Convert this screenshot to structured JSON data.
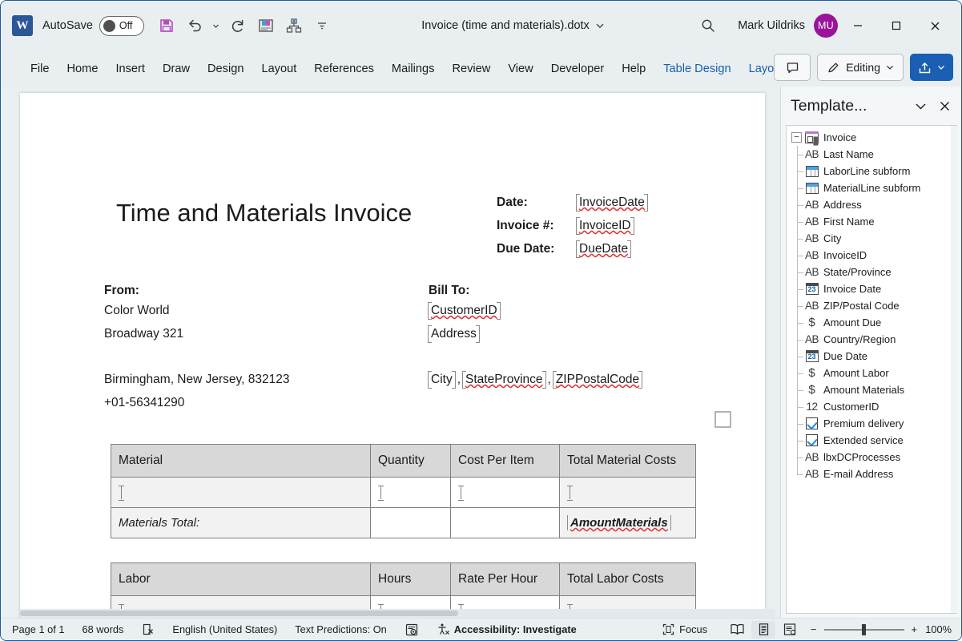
{
  "titlebar": {
    "app_logo": "W",
    "autosave_label": "AutoSave",
    "autosave_state": "Off",
    "quick_access": [
      {
        "name": "save-icon",
        "title": "Save"
      },
      {
        "name": "undo-icon",
        "title": "Undo"
      },
      {
        "name": "undo-dropdown-icon",
        "title": "Undo options"
      },
      {
        "name": "redo-icon",
        "title": "Redo"
      },
      {
        "name": "addin-icon",
        "title": "Add-in"
      },
      {
        "name": "hierarchy-icon",
        "title": "Organization"
      },
      {
        "name": "customize-qat-icon",
        "title": "Customize Quick Access Toolbar"
      }
    ],
    "document_title": "Invoice (time and materials).dotx",
    "search_icon": "search-icon",
    "user_name": "Mark Uildriks",
    "user_initials": "MU",
    "window_buttons": [
      "minimize",
      "maximize",
      "close"
    ]
  },
  "ribbon": {
    "tabs": [
      {
        "label": "File",
        "contextual": false
      },
      {
        "label": "Home",
        "contextual": false
      },
      {
        "label": "Insert",
        "contextual": false
      },
      {
        "label": "Draw",
        "contextual": false
      },
      {
        "label": "Design",
        "contextual": false
      },
      {
        "label": "Layout",
        "contextual": false
      },
      {
        "label": "References",
        "contextual": false
      },
      {
        "label": "Mailings",
        "contextual": false
      },
      {
        "label": "Review",
        "contextual": false
      },
      {
        "label": "View",
        "contextual": false
      },
      {
        "label": "Developer",
        "contextual": false
      },
      {
        "label": "Help",
        "contextual": false
      },
      {
        "label": "Table Design",
        "contextual": true
      },
      {
        "label": "Layout",
        "contextual": true
      }
    ],
    "comments_label": "Comments",
    "editing_label": "Editing",
    "share_label": "Share",
    "accent_color": "#1a5fb4",
    "contextual_color": "#1560ab"
  },
  "document": {
    "heading": "Time and Materials Invoice",
    "meta": [
      {
        "label": "Date:",
        "field": "InvoiceDate",
        "misspelled": true
      },
      {
        "label": "Invoice #:",
        "field": "InvoiceID",
        "misspelled": true
      },
      {
        "label": "Due Date:",
        "field": "DueDate",
        "misspelled": true
      }
    ],
    "from": {
      "heading": "From:",
      "lines": [
        "Color World",
        "Broadway 321"
      ],
      "address_line": "Birmingham, New Jersey, 832123",
      "phone": "+01-56341290"
    },
    "bill_to": {
      "heading": "Bill To:",
      "customer_field": "CustomerID",
      "address_field": "Address",
      "city_field": "City",
      "state_field": "StateProvince",
      "zip_field": "ZIPPostalCode",
      "separator": ","
    },
    "materials_table": {
      "headers": [
        "Material",
        "Quantity",
        "Cost Per Item",
        "Total Material Costs"
      ],
      "entry_row": [
        "",
        "",
        "",
        ""
      ],
      "total_label": "Materials Total:",
      "total_field": "AmountMaterials"
    },
    "labor_table": {
      "headers": [
        "Labor",
        "Hours",
        "Rate Per Hour",
        "Total Labor Costs"
      ],
      "entry_row": [
        "",
        "",
        "",
        ""
      ]
    }
  },
  "taskpane": {
    "title": "Template...",
    "collapse_icon": "chevron-down-icon",
    "close_icon": "close-icon",
    "tree": {
      "root": {
        "label": "Invoice",
        "icon": "form-icon",
        "expanded": true
      },
      "items": [
        {
          "label": "Last Name",
          "icon": "text-icon"
        },
        {
          "label": "LaborLine subform",
          "icon": "subform-icon"
        },
        {
          "label": "MaterialLine subform",
          "icon": "subform-icon"
        },
        {
          "label": "Address",
          "icon": "text-icon"
        },
        {
          "label": "First Name",
          "icon": "text-icon"
        },
        {
          "label": "City",
          "icon": "text-icon"
        },
        {
          "label": "InvoiceID",
          "icon": "text-icon"
        },
        {
          "label": "State/Province",
          "icon": "text-icon"
        },
        {
          "label": "Invoice Date",
          "icon": "date-icon"
        },
        {
          "label": "ZIP/Postal Code",
          "icon": "text-icon"
        },
        {
          "label": "Amount Due",
          "icon": "currency-icon"
        },
        {
          "label": "Country/Region",
          "icon": "text-icon"
        },
        {
          "label": "Due Date",
          "icon": "date-icon"
        },
        {
          "label": "Amount Labor",
          "icon": "currency-icon"
        },
        {
          "label": "Amount Materials",
          "icon": "currency-icon"
        },
        {
          "label": "CustomerID",
          "icon": "number-icon"
        },
        {
          "label": "Premium delivery",
          "icon": "checkbox-icon"
        },
        {
          "label": "Extended service",
          "icon": "checkbox-icon"
        },
        {
          "label": "lbxDCProcesses",
          "icon": "text-icon"
        },
        {
          "label": "E-mail Address",
          "icon": "text-icon"
        }
      ]
    }
  },
  "statusbar": {
    "page": "Page 1 of 1",
    "words": "68 words",
    "proofing_icon": "proofing-errors-icon",
    "language": "English (United States)",
    "text_predictions": "Text Predictions: On",
    "dictate_icon": "editor-icon",
    "accessibility": "Accessibility: Investigate",
    "focus": "Focus",
    "views": [
      {
        "name": "read-mode",
        "active": false
      },
      {
        "name": "print-layout",
        "active": true
      },
      {
        "name": "web-layout",
        "active": false
      }
    ],
    "zoom_out": "−",
    "zoom_in": "+",
    "zoom_level": "100%"
  },
  "icon_glyphs": {
    "text": "AB",
    "number": "12",
    "currency": "$",
    "date": "23"
  }
}
